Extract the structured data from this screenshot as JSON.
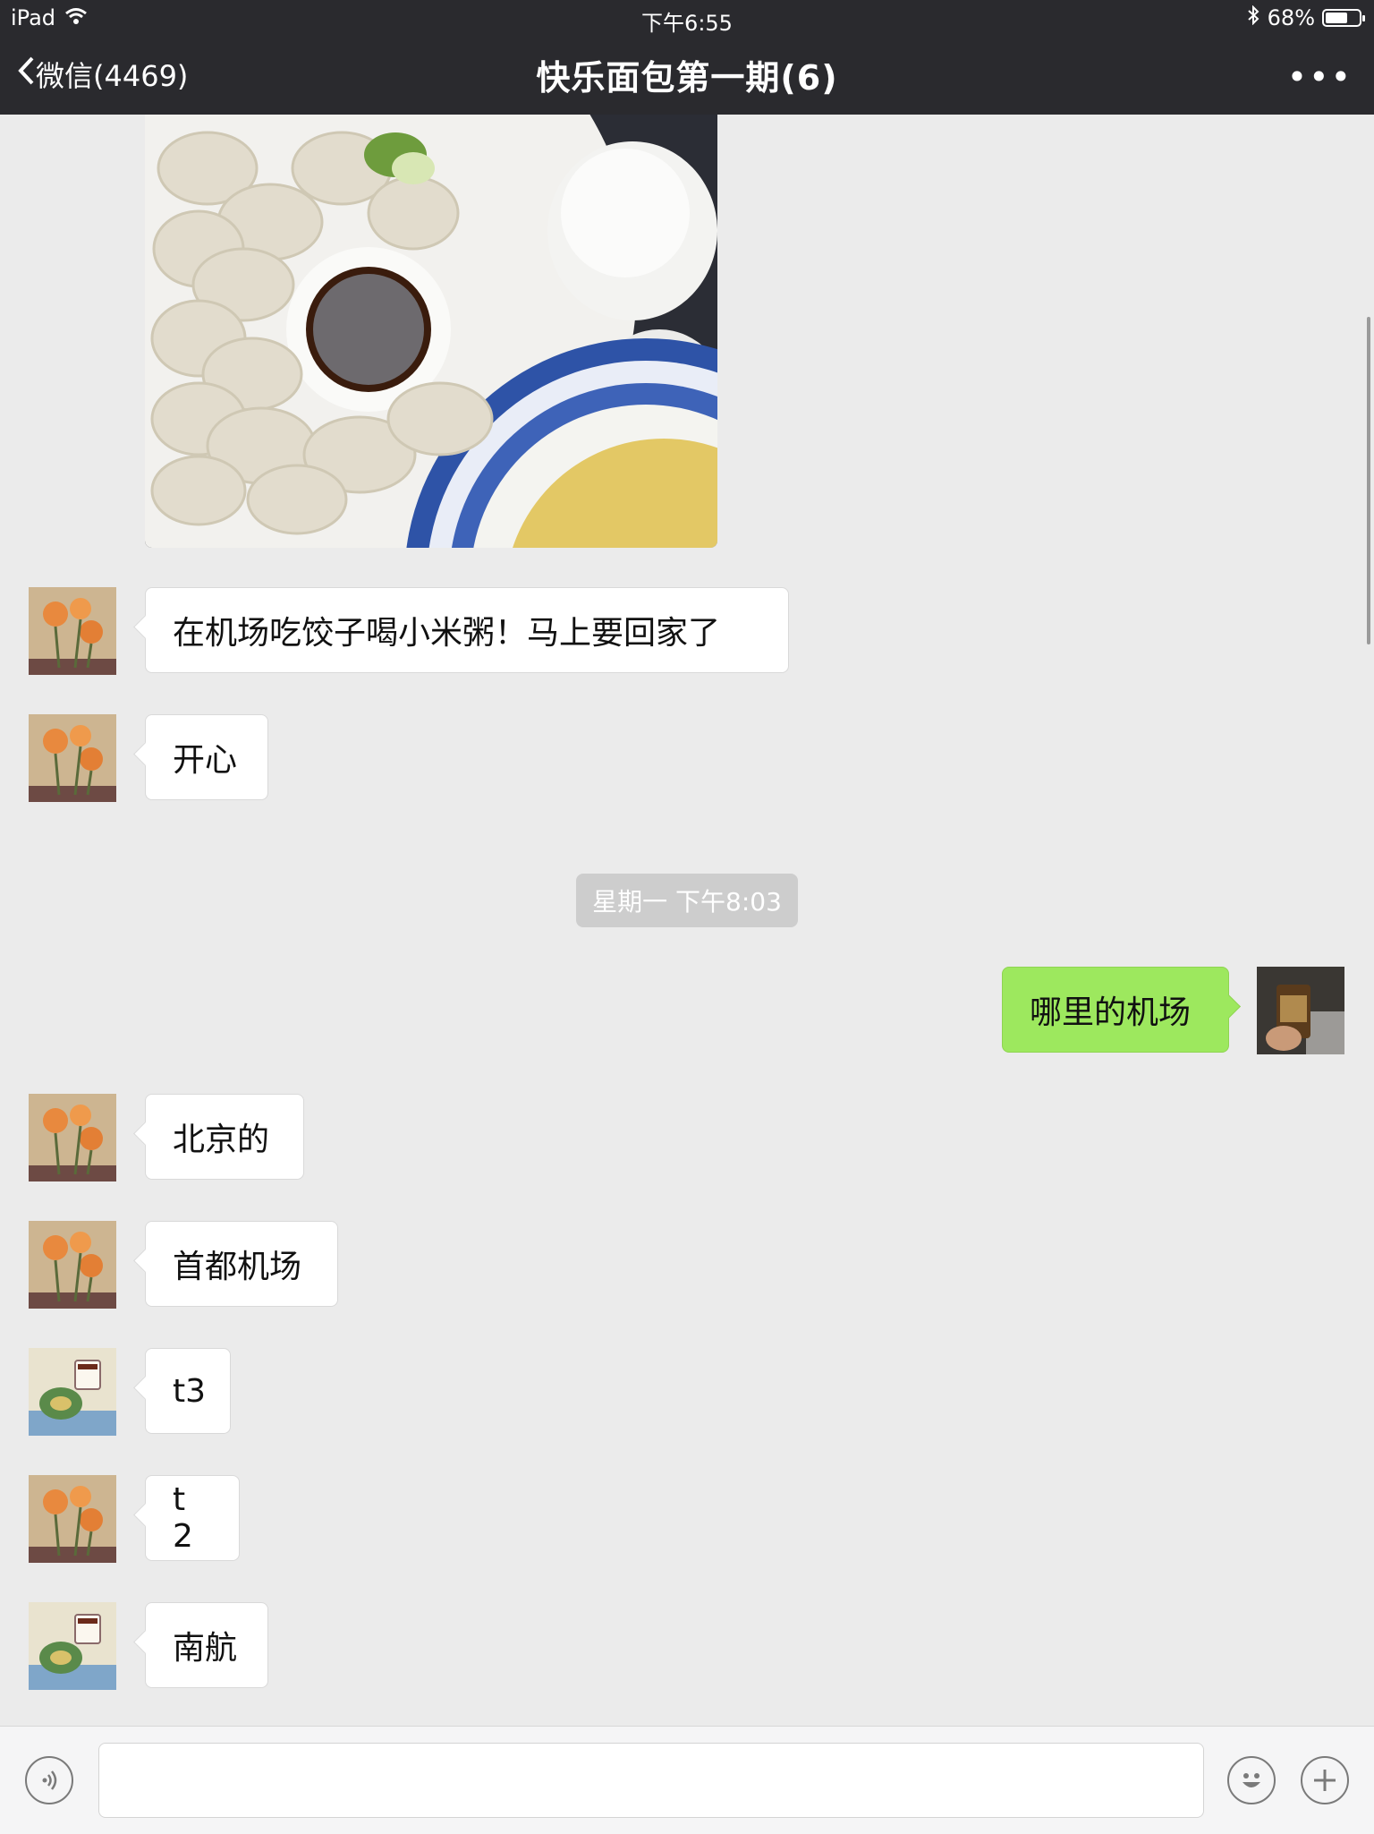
{
  "status_bar": {
    "device": "iPad",
    "time": "下午6:55",
    "battery_percent": "68%",
    "battery_level": 0.68
  },
  "nav": {
    "back_label": "微信(4469)",
    "title": "快乐面包第一期(6)",
    "more_label": "•••"
  },
  "messages": {
    "m1": "在机场吃饺子喝小米粥！马上要回家了",
    "m2": "开心",
    "timestamp": "星期一 下午8:03",
    "m3": "哪里的机场",
    "m4": "北京的",
    "m5": "首都机场",
    "m6": "t3",
    "m7": "t 2",
    "m8": "南航"
  },
  "input": {
    "placeholder": ""
  },
  "colors": {
    "header_bg": "#2a2a2e",
    "chat_bg": "#ebebeb",
    "sent_bubble": "#9de85e",
    "received_bubble": "#ffffff"
  },
  "icons": {
    "status": [
      "wifi-icon",
      "bluetooth-icon",
      "battery-icon"
    ],
    "nav": [
      "chevron-left-icon",
      "more-icon"
    ],
    "bottom": [
      "voice-icon",
      "emoji-icon",
      "plus-icon"
    ]
  }
}
